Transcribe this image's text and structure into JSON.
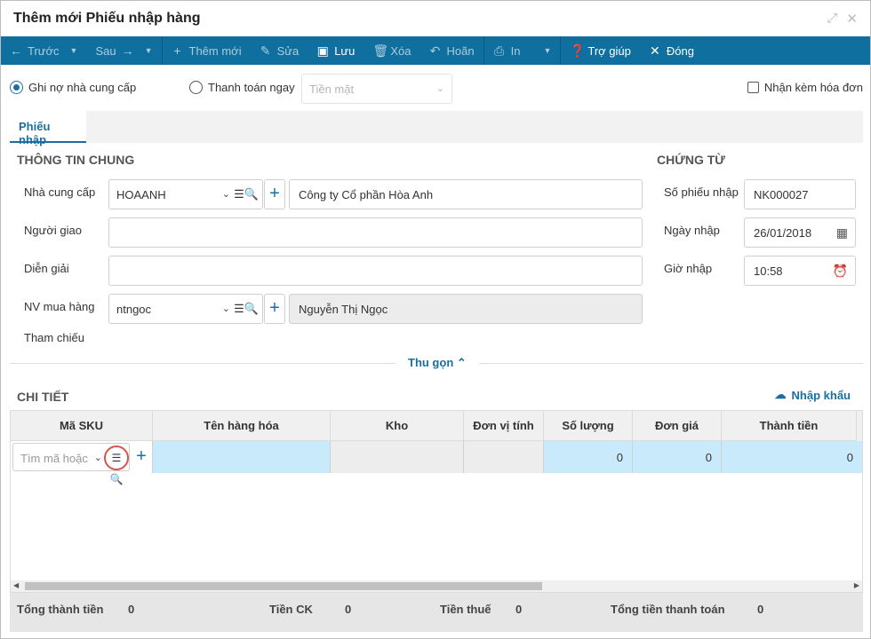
{
  "window": {
    "title": "Thêm mới Phiếu nhập hàng"
  },
  "toolbar": {
    "prev": "Trước",
    "next": "Sau",
    "add": "Thêm mới",
    "edit": "Sửa",
    "save": "Lưu",
    "delete": "Xóa",
    "undo": "Hoãn",
    "print": "In",
    "help": "Trợ giúp",
    "close": "Đóng"
  },
  "options": {
    "debt_label": "Ghi nợ nhà cung cấp",
    "pay_now_label": "Thanh toán ngay",
    "payment_method_placeholder": "Tiền mặt",
    "invoice_label": "Nhận kèm hóa đơn"
  },
  "tabs": [
    {
      "label": "Phiếu nhập"
    }
  ],
  "general": {
    "title": "THÔNG TIN CHUNG",
    "supplier_label": "Nhà cung cấp",
    "supplier_code": "HOAANH",
    "supplier_name": "Công ty Cổ phần Hòa Anh",
    "deliverer_label": "Người giao",
    "deliverer_value": "",
    "description_label": "Diễn giải",
    "description_value": "",
    "buyer_label": "NV mua hàng",
    "buyer_code": "ntngoc",
    "buyer_name": "Nguyễn Thị Ngọc",
    "reference_label": "Tham chiếu"
  },
  "voucher": {
    "title": "CHỨNG TỪ",
    "number_label": "Số phiếu nhập",
    "number_value": "NK000027",
    "date_label": "Ngày nhập",
    "date_value": "26/01/2018",
    "time_label": "Giờ nhập",
    "time_value": "10:58"
  },
  "collapse_label": "Thu gọn",
  "detail": {
    "title": "CHI TIẾT",
    "import_label": "Nhập khẩu",
    "columns": [
      "Mã SKU",
      "Tên hàng hóa",
      "Kho",
      "Đơn vị tính",
      "Số lượng",
      "Đơn giá",
      "Thành tiền"
    ],
    "sku_placeholder": "Tìm mã hoặc",
    "row": {
      "quantity": "0",
      "price": "0",
      "amount": "0"
    }
  },
  "totals": {
    "total_label": "Tổng thành tiền",
    "total_value": "0",
    "discount_label": "Tiền CK",
    "discount_value": "0",
    "tax_label": "Tiền thuế",
    "tax_value": "0",
    "grand_label": "Tổng tiền thanh toán",
    "grand_value": "0"
  },
  "colors": {
    "primary": "#0f6f9e",
    "accent": "#1a6fa0",
    "row_highlight": "#c8eafa",
    "alert_ring": "#d9534f"
  },
  "icons": [
    "arrow-left-icon",
    "arrow-right-icon",
    "plus-icon",
    "pencil-icon",
    "save-icon",
    "trash-icon",
    "undo-icon",
    "printer-icon",
    "help-icon",
    "close-icon",
    "search-list-icon",
    "calendar-icon",
    "clock-icon",
    "cloud-download-icon",
    "chevron-up-icon",
    "chevron-down-icon",
    "expand-icon"
  ]
}
